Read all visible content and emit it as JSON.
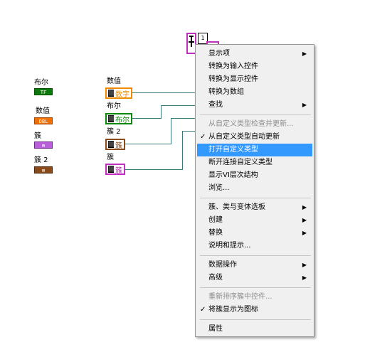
{
  "palette": {
    "labels": [
      {
        "id": "bool",
        "label": "布尔",
        "terminal": "TF"
      },
      {
        "id": "num",
        "label": "数值",
        "terminal": "DBL"
      },
      {
        "id": "cluster",
        "label": "簇",
        "terminal": "⊞"
      },
      {
        "id": "cluster2",
        "label": "簇 2",
        "terminal": "⊞"
      }
    ]
  },
  "constants": [
    {
      "label": "数值",
      "value": "数字"
    },
    {
      "label": "布尔",
      "value": "布尔"
    },
    {
      "label": "簇 2",
      "value": "簇"
    },
    {
      "label": "簇",
      "value": "簇"
    }
  ],
  "node": {
    "index": "1"
  },
  "context_menu": {
    "items": [
      {
        "label": "显示项",
        "submenu": true
      },
      {
        "label": "转换为输入控件"
      },
      {
        "label": "转换为显示控件"
      },
      {
        "label": "转换为数组"
      },
      {
        "label": "查找",
        "submenu": true
      },
      {
        "separator": true
      },
      {
        "label": "从自定义类型检查并更新...",
        "disabled": true
      },
      {
        "label": "从自定义类型自动更新",
        "checked": true
      },
      {
        "label": "打开自定义类型",
        "highlighted": true
      },
      {
        "label": "断开连接自定义类型"
      },
      {
        "label": "显示VI层次结构"
      },
      {
        "label": "浏览..."
      },
      {
        "separator": true
      },
      {
        "label": "簇、类与变体选板",
        "submenu": true
      },
      {
        "label": "创建",
        "submenu": true
      },
      {
        "label": "替换",
        "submenu": true
      },
      {
        "label": "说明和提示..."
      },
      {
        "separator": true
      },
      {
        "label": "数据操作",
        "submenu": true
      },
      {
        "label": "高级",
        "submenu": true
      },
      {
        "separator": true
      },
      {
        "label": "重新排序簇中控件...",
        "disabled": true
      },
      {
        "label": "将簇显示为图标",
        "checked": true
      },
      {
        "separator": true
      },
      {
        "label": "属性"
      }
    ],
    "check_glyph": "✓",
    "arrow_glyph": "▶"
  },
  "colors": {
    "highlight": "#3399ff",
    "wire": "#3a7a7a"
  }
}
